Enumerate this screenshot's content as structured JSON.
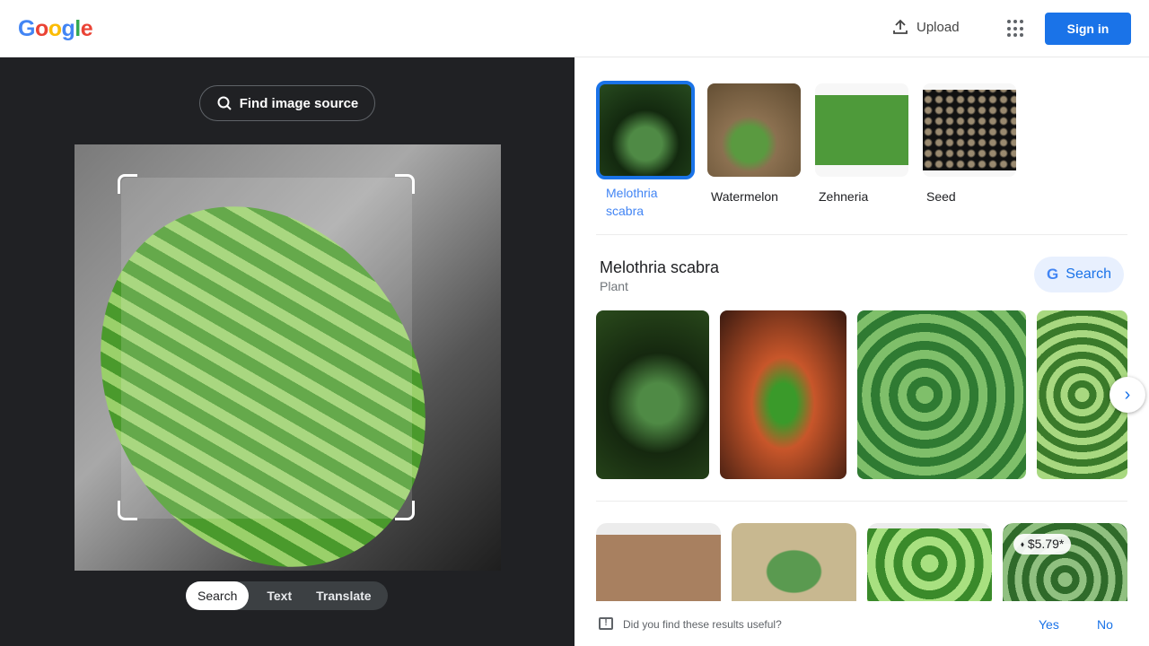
{
  "header": {
    "logo": "Google",
    "upload_label": "Upload",
    "signin_label": "Sign in"
  },
  "left": {
    "find_source_label": "Find image source",
    "modes": [
      "Search",
      "Text",
      "Translate"
    ],
    "active_mode": "Search"
  },
  "chips": [
    {
      "label": "Melothria scabra",
      "selected": true
    },
    {
      "label": "Watermelon",
      "selected": false
    },
    {
      "label": "Zehneria",
      "selected": false
    },
    {
      "label": "Seed",
      "selected": false
    }
  ],
  "entity": {
    "title": "Melothria scabra",
    "subtitle": "Plant",
    "search_label": "Search"
  },
  "results": {
    "price_badge": "$5.79*"
  },
  "feedback": {
    "question": "Did you find these results useful?",
    "yes": "Yes",
    "no": "No"
  },
  "colors": {
    "accent": "#1a73e8",
    "dark_panel": "#202124"
  }
}
